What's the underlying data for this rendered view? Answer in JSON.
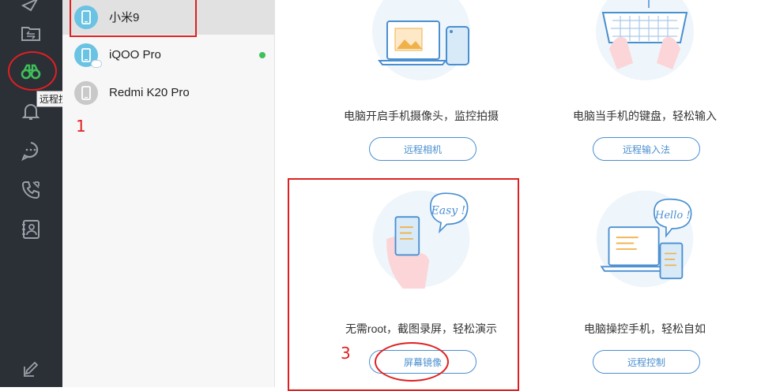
{
  "sidebar": {
    "tooltip": "远程控制"
  },
  "devices": [
    {
      "name": "小米9",
      "selected": true,
      "online": false
    },
    {
      "name": "iQOO Pro",
      "selected": false,
      "online": true
    },
    {
      "name": "Redmi K20 Pro",
      "selected": false,
      "online": false
    }
  ],
  "cards": {
    "camera": {
      "desc": "电脑开启手机摄像头，监控拍摄",
      "button": "远程相机"
    },
    "keyboard": {
      "desc": "电脑当手机的键盘，轻松输入",
      "button": "远程输入法"
    },
    "mirror": {
      "desc": "无需root，截图录屏，轻松演示",
      "button": "屏幕镜像",
      "bubble": "Easy !"
    },
    "control": {
      "desc": "电脑操控手机，轻松自如",
      "button": "远程控制",
      "bubble": "Hello !"
    }
  },
  "annotations": {
    "step1": "1",
    "step3": "3"
  },
  "colors": {
    "sidebar": "#2b2f36",
    "accent": "#4a8fd0",
    "annotation": "#e02020",
    "online": "#3ec05a",
    "active_icon": "#3ec05a"
  }
}
